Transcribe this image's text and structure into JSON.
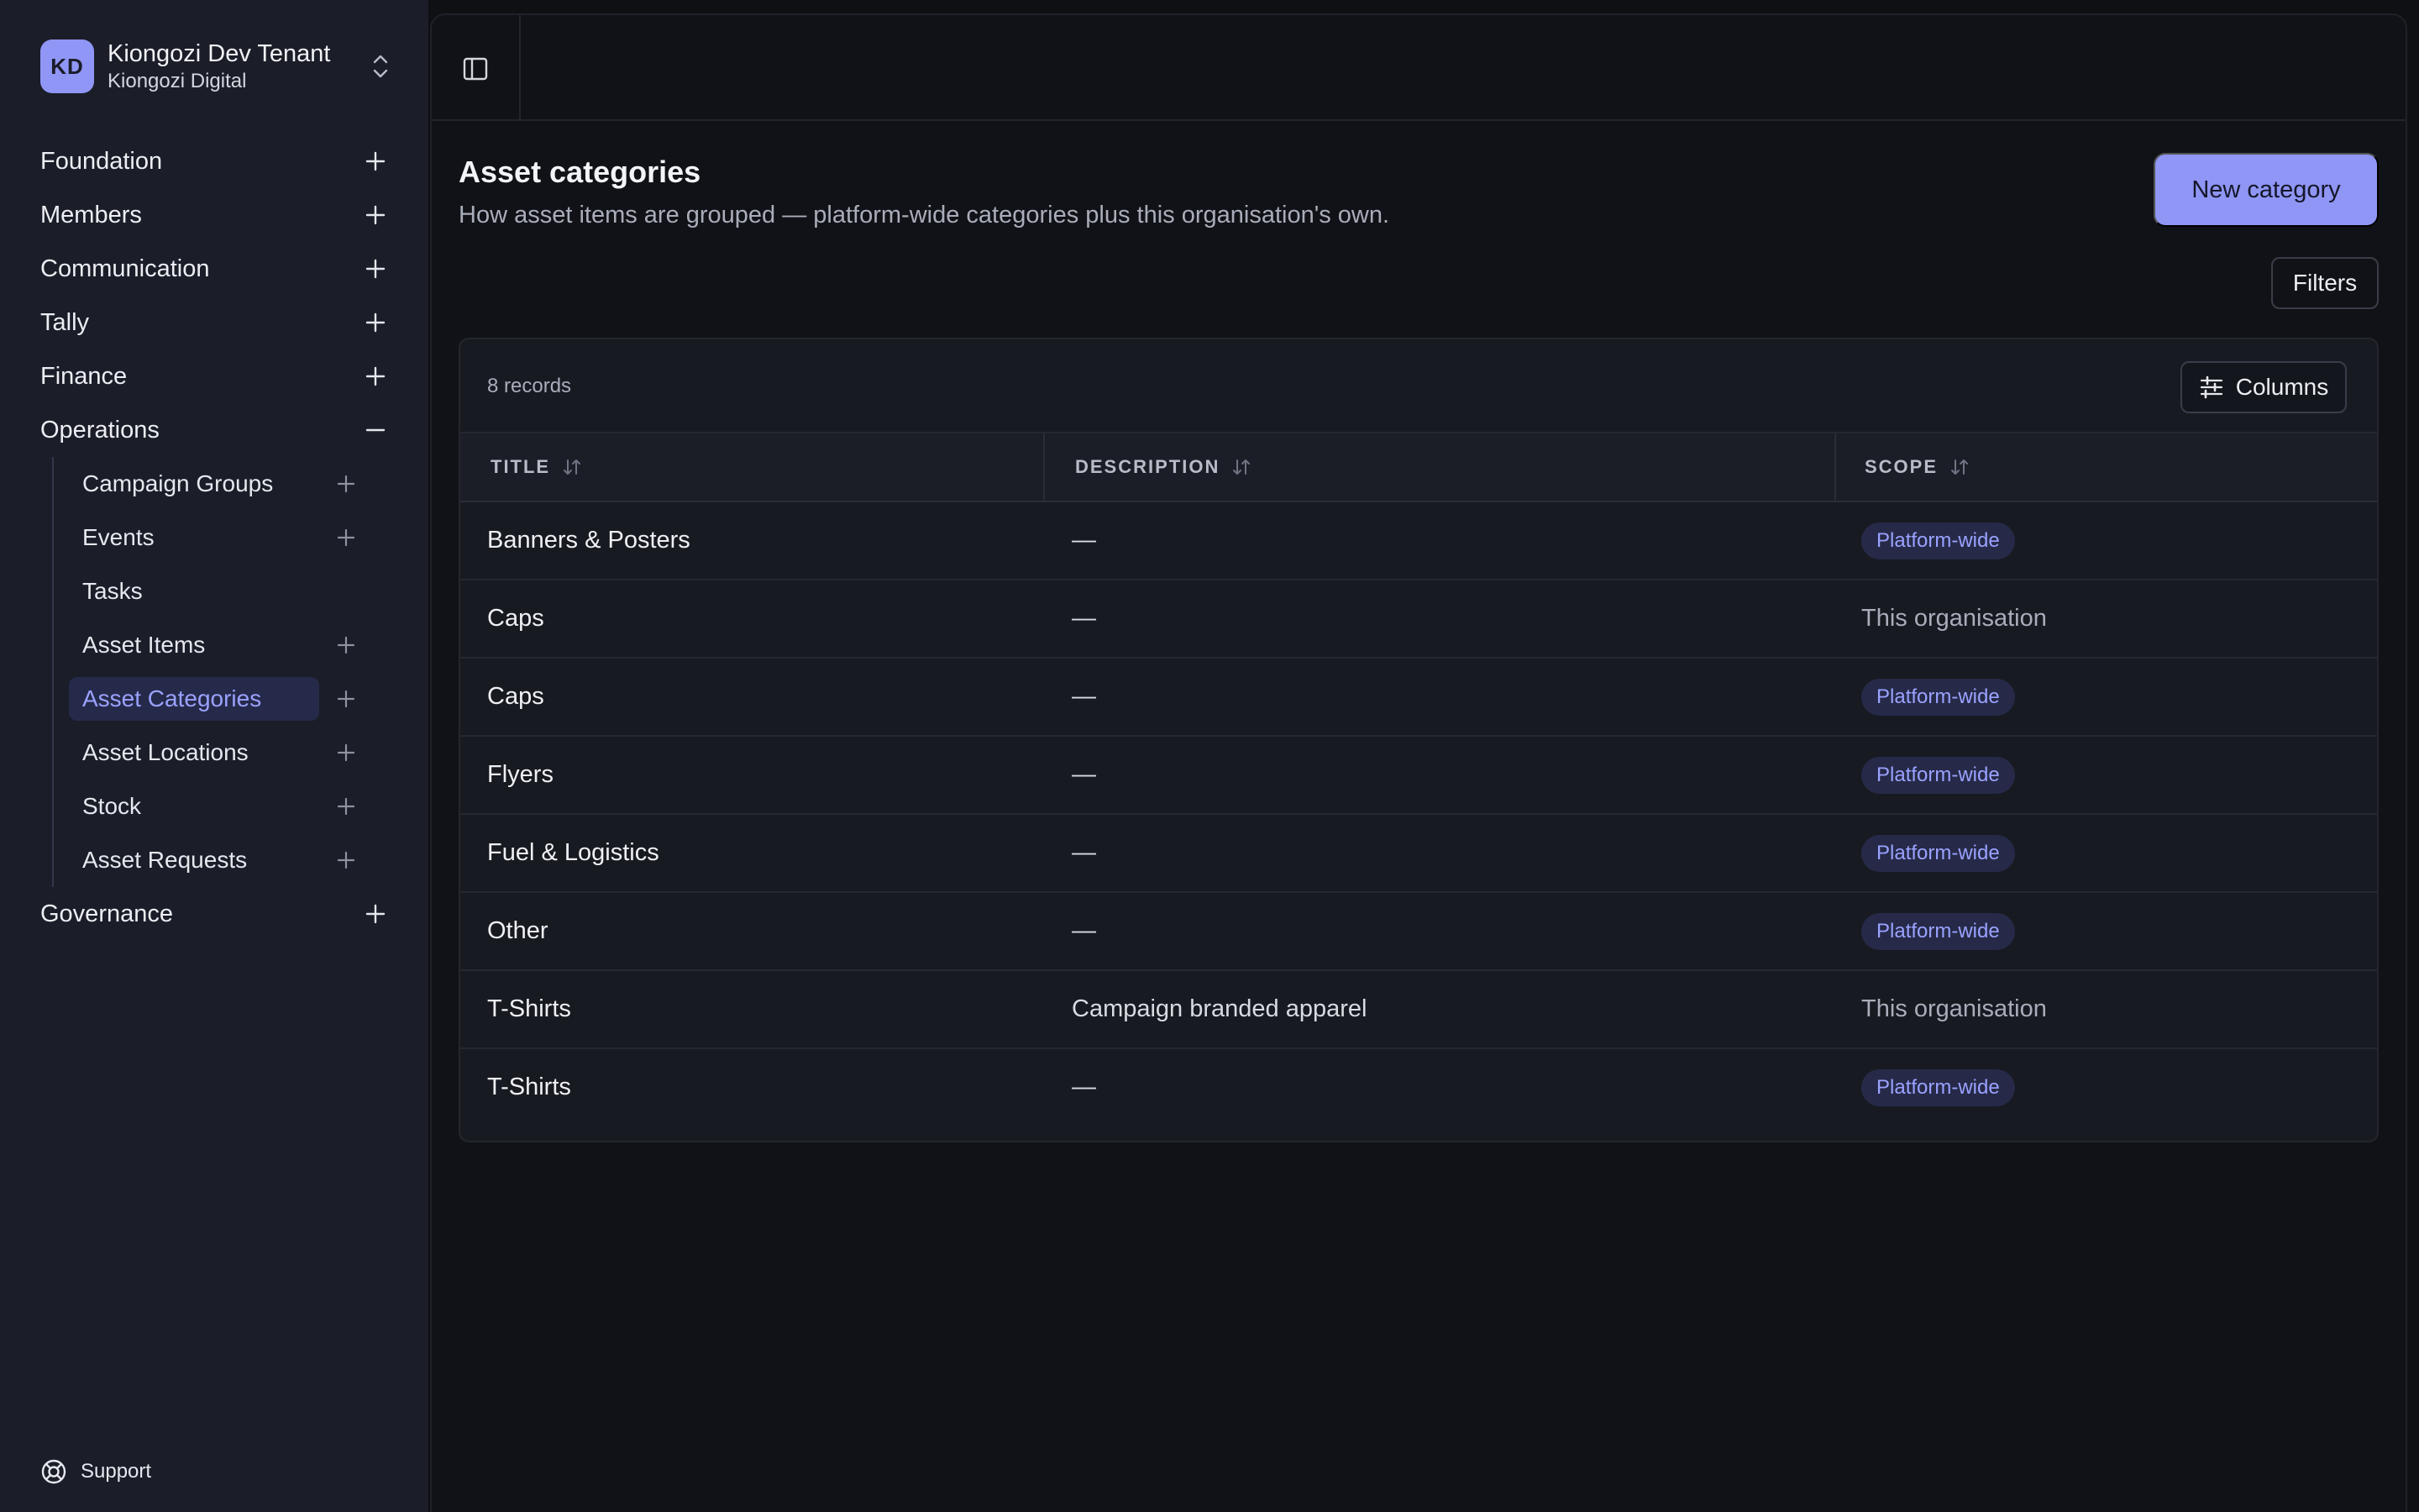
{
  "tenant": {
    "initials": "KD",
    "name": "Kiongozi Dev Tenant",
    "org": "Kiongozi Digital"
  },
  "nav": {
    "items": [
      {
        "label": "Foundation"
      },
      {
        "label": "Members"
      },
      {
        "label": "Communication"
      },
      {
        "label": "Tally"
      },
      {
        "label": "Finance"
      },
      {
        "label": "Operations"
      }
    ],
    "operations_children": [
      {
        "label": "Campaign Groups",
        "addable": true
      },
      {
        "label": "Events",
        "addable": true
      },
      {
        "label": "Tasks",
        "addable": false
      },
      {
        "label": "Asset Items",
        "addable": true
      },
      {
        "label": "Asset Categories",
        "addable": true,
        "active": true
      },
      {
        "label": "Asset Locations",
        "addable": true
      },
      {
        "label": "Stock",
        "addable": true
      },
      {
        "label": "Asset Requests",
        "addable": true
      }
    ],
    "after": [
      {
        "label": "Governance"
      }
    ],
    "support_label": "Support"
  },
  "page": {
    "title": "Asset categories",
    "subtitle": "How asset items are grouped — platform-wide categories plus this organisation's own.",
    "new_button": "New category",
    "filters_button": "Filters"
  },
  "table": {
    "records_label": "8 records",
    "columns_button": "Columns",
    "headers": [
      "TITLE",
      "DESCRIPTION",
      "SCOPE"
    ],
    "rows": [
      {
        "title": "Banners & Posters",
        "description": "—",
        "scope": "Platform-wide",
        "scope_badge": true
      },
      {
        "title": "Caps",
        "description": "—",
        "scope": "This organisation",
        "scope_badge": false
      },
      {
        "title": "Caps",
        "description": "—",
        "scope": "Platform-wide",
        "scope_badge": true
      },
      {
        "title": "Flyers",
        "description": "—",
        "scope": "Platform-wide",
        "scope_badge": true
      },
      {
        "title": "Fuel & Logistics",
        "description": "—",
        "scope": "Platform-wide",
        "scope_badge": true
      },
      {
        "title": "Other",
        "description": "—",
        "scope": "Platform-wide",
        "scope_badge": true
      },
      {
        "title": "T-Shirts",
        "description": "Campaign branded apparel",
        "scope": "This organisation",
        "scope_badge": false
      },
      {
        "title": "T-Shirts",
        "description": "—",
        "scope": "Platform-wide",
        "scope_badge": true
      }
    ]
  },
  "colors": {
    "accent": "#8f96f5",
    "sidebar_bg": "#1b1d28",
    "main_bg": "#111217",
    "badge_bg": "#262a48",
    "badge_text": "#9aa2ff"
  }
}
